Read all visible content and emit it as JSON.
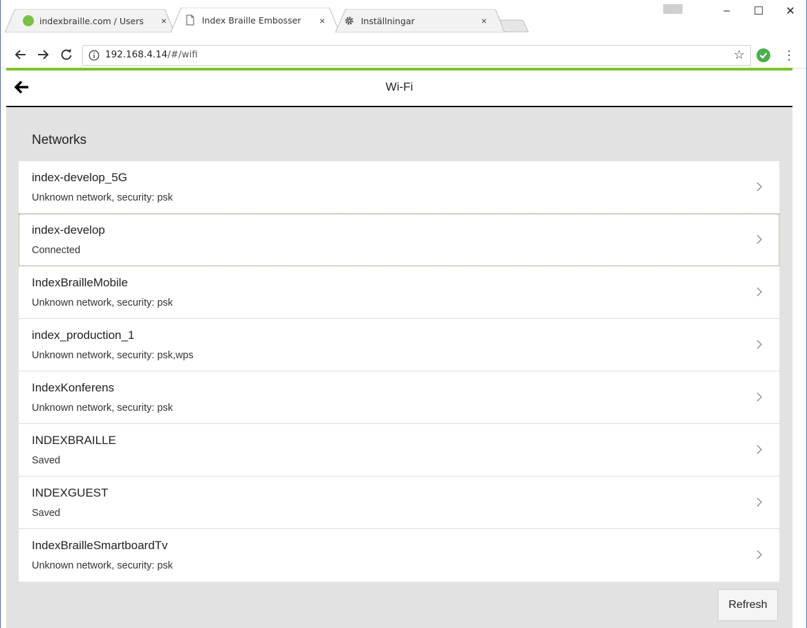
{
  "browser": {
    "tabs": [
      {
        "title": "indexbraille.com / Users",
        "icon": "green-dot-icon"
      },
      {
        "title": "Index Braille Embosser",
        "icon": "page-icon"
      },
      {
        "title": "Inställningar",
        "icon": "gear-icon"
      }
    ],
    "tab_close": "×",
    "url_host": "192.168.4.14",
    "url_path": "/#/wifi",
    "window": {
      "minimize": "–",
      "maximize": "☐",
      "close": "✕"
    }
  },
  "header": {
    "title": "Wi-Fi",
    "back_icon": "arrow-left-icon"
  },
  "networks": {
    "title": "Networks",
    "items": [
      {
        "name": "index-develop_5G",
        "status": "Unknown network, security: psk"
      },
      {
        "name": "index-develop",
        "status": "Connected"
      },
      {
        "name": "IndexBrailleMobile",
        "status": "Unknown network, security: psk"
      },
      {
        "name": "index_production_1",
        "status": "Unknown network, security: psk,wps"
      },
      {
        "name": "IndexKonferens",
        "status": "Unknown network, security: psk"
      },
      {
        "name": "INDEXBRAILLE",
        "status": "Saved"
      },
      {
        "name": "INDEXGUEST",
        "status": "Saved"
      },
      {
        "name": "IndexBrailleSmartboardTv",
        "status": "Unknown network, security: psk"
      }
    ]
  },
  "actions": {
    "refresh_label": "Refresh"
  },
  "colors": {
    "accent_green": "#7dc22b",
    "content_bg": "#e2e2e2"
  }
}
